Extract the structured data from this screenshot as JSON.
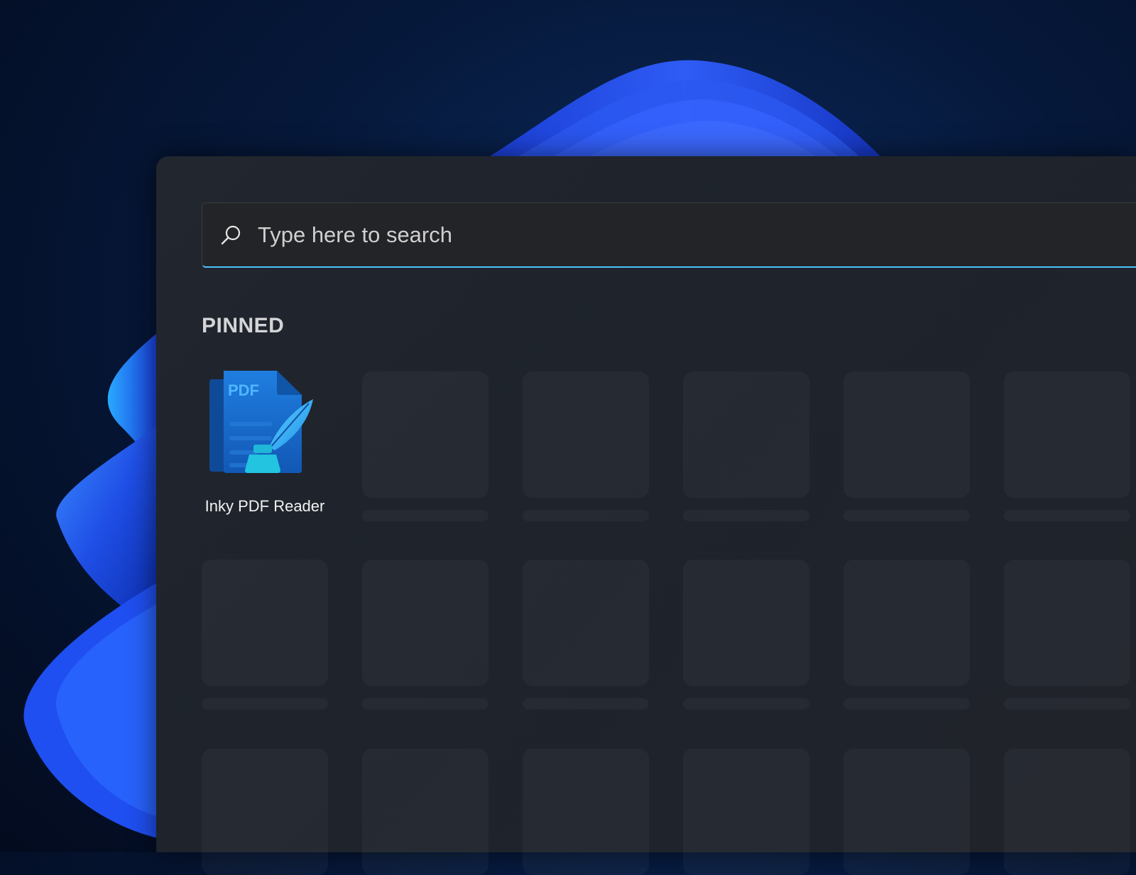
{
  "search": {
    "placeholder": "Type here to search",
    "value": ""
  },
  "pinned": {
    "heading": "PINNED",
    "apps": [
      {
        "label": "Inky PDF Reader",
        "icon": "pdf-reader-icon",
        "icon_text": "PDF"
      }
    ]
  },
  "colors": {
    "accent": "#4cc2ff",
    "panel": "#202329",
    "wallpaper_bloom": "#1f5cff"
  }
}
